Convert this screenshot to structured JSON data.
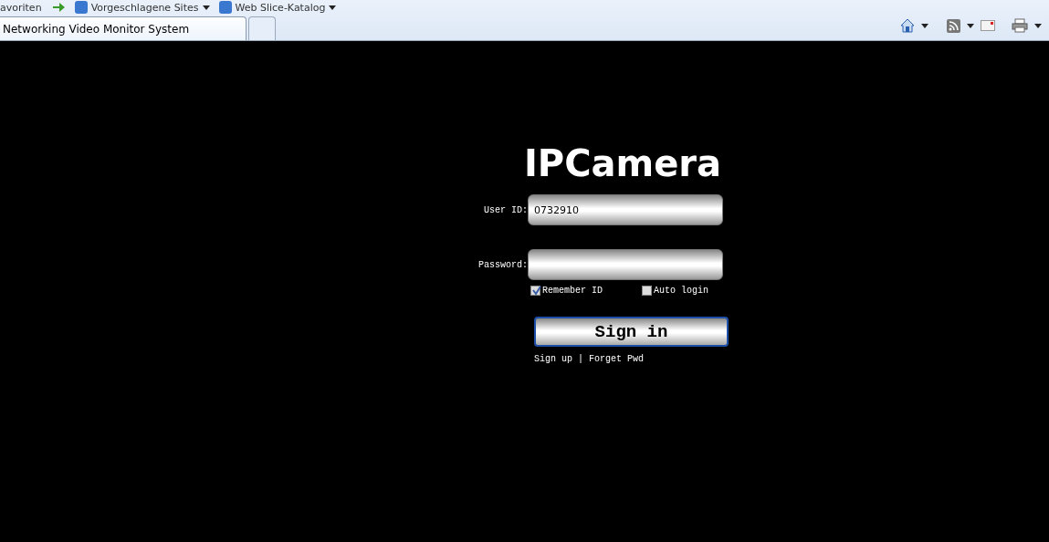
{
  "favorites_bar": {
    "items": [
      {
        "label": "avoriten",
        "kind": "text"
      },
      {
        "label": "Vorgeschlagene Sites",
        "kind": "link"
      },
      {
        "label": "Web Slice-Katalog",
        "kind": "link"
      }
    ]
  },
  "tabs": [
    {
      "label": "Networking Video Monitor System",
      "selected": true
    }
  ],
  "login": {
    "title": "IPCamera",
    "user_id": {
      "label": "User ID:",
      "value": "0732910"
    },
    "password": {
      "label": "Password:"
    },
    "options": [
      {
        "label": "Remember ID",
        "checked": true
      },
      {
        "label": "Auto login",
        "checked": false
      }
    ],
    "sign_in": "Sign in",
    "links": [
      "Sign up",
      "Forget Pwd"
    ],
    "separator": "|"
  }
}
